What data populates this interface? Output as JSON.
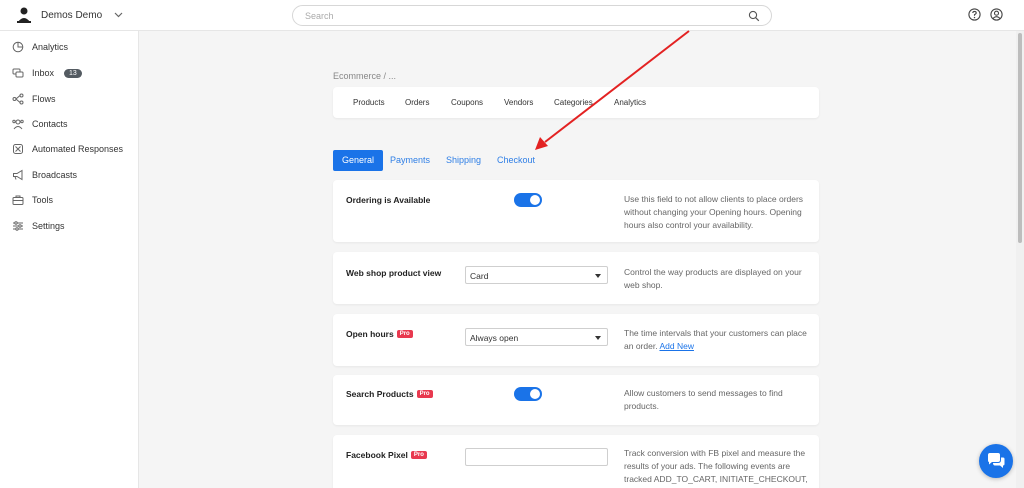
{
  "header": {
    "account_name": "Demos Demo",
    "search_placeholder": "Search"
  },
  "sidebar": {
    "items": [
      {
        "label": "Analytics",
        "icon": "analytics-icon"
      },
      {
        "label": "Inbox",
        "icon": "inbox-icon",
        "badge": "13"
      },
      {
        "label": "Flows",
        "icon": "flows-icon"
      },
      {
        "label": "Contacts",
        "icon": "contacts-icon"
      },
      {
        "label": "Automated Responses",
        "icon": "automated-responses-icon"
      },
      {
        "label": "Broadcasts",
        "icon": "broadcasts-icon"
      },
      {
        "label": "Tools",
        "icon": "tools-icon"
      },
      {
        "label": "Settings",
        "icon": "settings-icon"
      }
    ]
  },
  "breadcrumb": "Ecommerce  /  ...",
  "section_tabs": [
    "Products",
    "Orders",
    "Coupons",
    "Vendors",
    "Categories",
    "Analytics"
  ],
  "sub_tabs": {
    "active": "General",
    "items": [
      "General",
      "Payments",
      "Shipping",
      "Checkout"
    ]
  },
  "settings": {
    "ordering": {
      "label": "Ordering is Available",
      "toggle_on": true,
      "description": "Use this field to not allow clients to place orders without changing your Opening hours. Opening hours also control your availability."
    },
    "product_view": {
      "label": "Web shop product view",
      "value": "Card",
      "description": "Control the way products are displayed on your web shop."
    },
    "open_hours": {
      "label": "Open hours",
      "pro": "Pro",
      "value": "Always open",
      "description": "The time intervals that your customers can place an order.",
      "link": "Add New"
    },
    "search_products": {
      "label": "Search Products",
      "pro": "Pro",
      "toggle_on": true,
      "description": "Allow customers to send messages to find products."
    },
    "facebook_pixel": {
      "label": "Facebook Pixel",
      "pro": "Pro",
      "value": "",
      "description": "Track conversion with FB pixel and measure the results of your ads. The following events are tracked ADD_TO_CART, INITIATE_CHECKOUT,"
    }
  },
  "colors": {
    "accent": "#1a73e8",
    "pro_badge": "#e8394f",
    "annotation_arrow": "#e32222"
  }
}
